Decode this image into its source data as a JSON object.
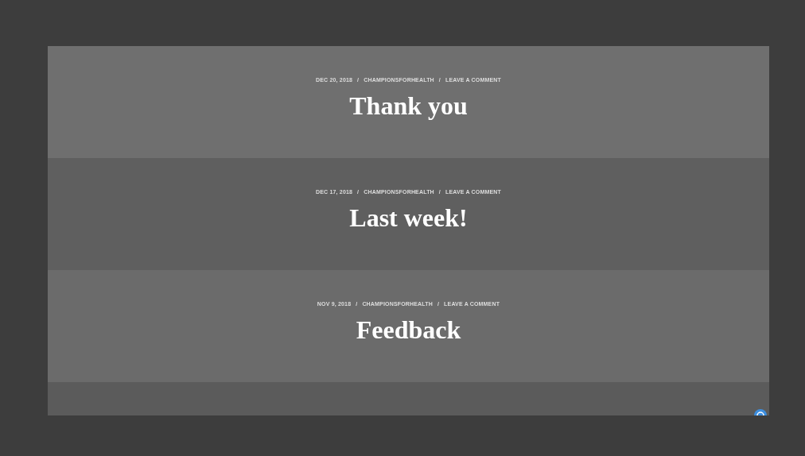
{
  "posts": [
    {
      "date": "DEC 20, 2018",
      "author": "CHAMPIONSFORHEALTH",
      "comments": "LEAVE A COMMENT",
      "title": "Thank you"
    },
    {
      "date": "DEC 17, 2018",
      "author": "CHAMPIONSFORHEALTH",
      "comments": "LEAVE A COMMENT",
      "title": "Last week!"
    },
    {
      "date": "NOV 9, 2018",
      "author": "CHAMPIONSFORHEALTH",
      "comments": "LEAVE A COMMENT",
      "title": "Feedback"
    }
  ],
  "separator": "/"
}
